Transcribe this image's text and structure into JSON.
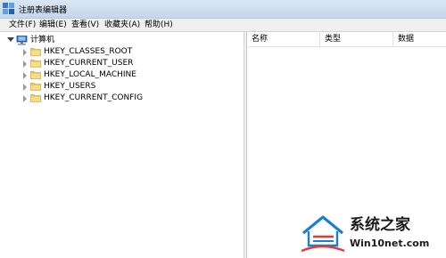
{
  "window": {
    "title": "注册表编辑器"
  },
  "menu": {
    "items": [
      "文件(F)",
      "编辑(E)",
      "查看(V)",
      "收藏夹(A)",
      "帮助(H)"
    ]
  },
  "tree": {
    "root": {
      "label": "计算机",
      "expanded": true
    },
    "children": [
      {
        "label": "HKEY_CLASSES_ROOT"
      },
      {
        "label": "HKEY_CURRENT_USER"
      },
      {
        "label": "HKEY_LOCAL_MACHINE"
      },
      {
        "label": "HKEY_USERS"
      },
      {
        "label": "HKEY_CURRENT_CONFIG"
      }
    ]
  },
  "list": {
    "columns": [
      "名称",
      "类型",
      "数据"
    ]
  },
  "watermark": {
    "brand": "系统之家",
    "site": "Win10net.com"
  },
  "colors": {
    "titlebar": "#c5d6ec",
    "folder": "#e8c25a",
    "logo_blue": "#1a7fd0"
  }
}
